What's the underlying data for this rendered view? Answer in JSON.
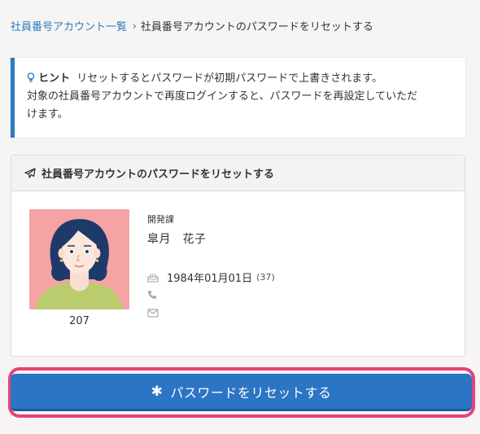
{
  "breadcrumb": {
    "parent": "社員番号アカウント一覧",
    "separator": "›",
    "current": "社員番号アカウントのパスワードをリセットする"
  },
  "hint": {
    "label": "ヒント",
    "text_line1": "リセットするとパスワードが初期パスワードで上書きされます。",
    "text_line2": "対象の社員番号アカウントで再度ログインすると、パスワードを再設定していただ",
    "text_line3": "けます。"
  },
  "card": {
    "title": "社員番号アカウントのパスワードをリセットする",
    "employee": {
      "number": "207",
      "department": "開発課",
      "name": "皐月　花子",
      "birthday": "1984年01月01日",
      "age": "(37)",
      "phone": "",
      "email": ""
    }
  },
  "action": {
    "label": "パスワードをリセットする",
    "icon": "asterisk-icon"
  },
  "colors": {
    "accent": "#2c74c4",
    "highlight": "#e8417a",
    "avatar_bg": "#f5a3a3"
  }
}
